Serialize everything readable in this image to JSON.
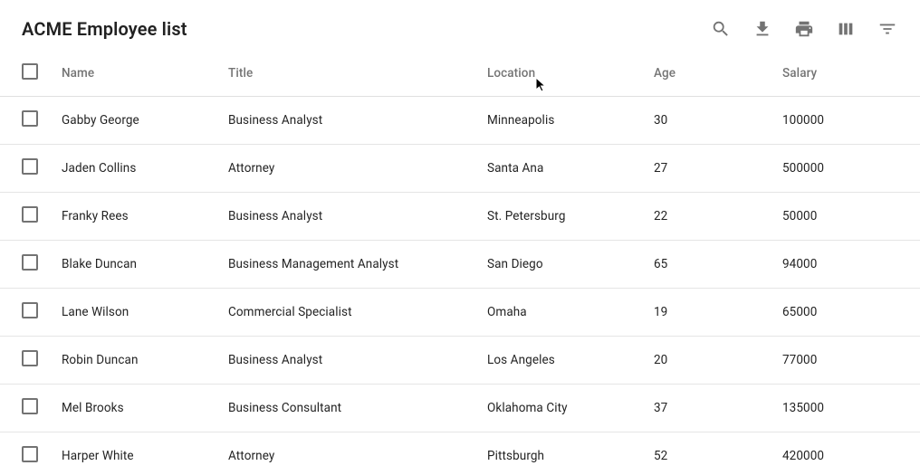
{
  "title": "ACME Employee list",
  "columns": {
    "name": "Name",
    "title": "Title",
    "location": "Location",
    "age": "Age",
    "salary": "Salary"
  },
  "rows": [
    {
      "name": "Gabby George",
      "title": "Business Analyst",
      "location": "Minneapolis",
      "age": "30",
      "salary": "100000"
    },
    {
      "name": "Jaden Collins",
      "title": "Attorney",
      "location": "Santa Ana",
      "age": "27",
      "salary": "500000"
    },
    {
      "name": "Franky Rees",
      "title": "Business Analyst",
      "location": "St. Petersburg",
      "age": "22",
      "salary": "50000"
    },
    {
      "name": "Blake Duncan",
      "title": "Business Management Analyst",
      "location": "San Diego",
      "age": "65",
      "salary": "94000"
    },
    {
      "name": "Lane Wilson",
      "title": "Commercial Specialist",
      "location": "Omaha",
      "age": "19",
      "salary": "65000"
    },
    {
      "name": "Robin Duncan",
      "title": "Business Analyst",
      "location": "Los Angeles",
      "age": "20",
      "salary": "77000"
    },
    {
      "name": "Mel Brooks",
      "title": "Business Consultant",
      "location": "Oklahoma City",
      "age": "37",
      "salary": "135000"
    },
    {
      "name": "Harper White",
      "title": "Attorney",
      "location": "Pittsburgh",
      "age": "52",
      "salary": "420000"
    }
  ]
}
